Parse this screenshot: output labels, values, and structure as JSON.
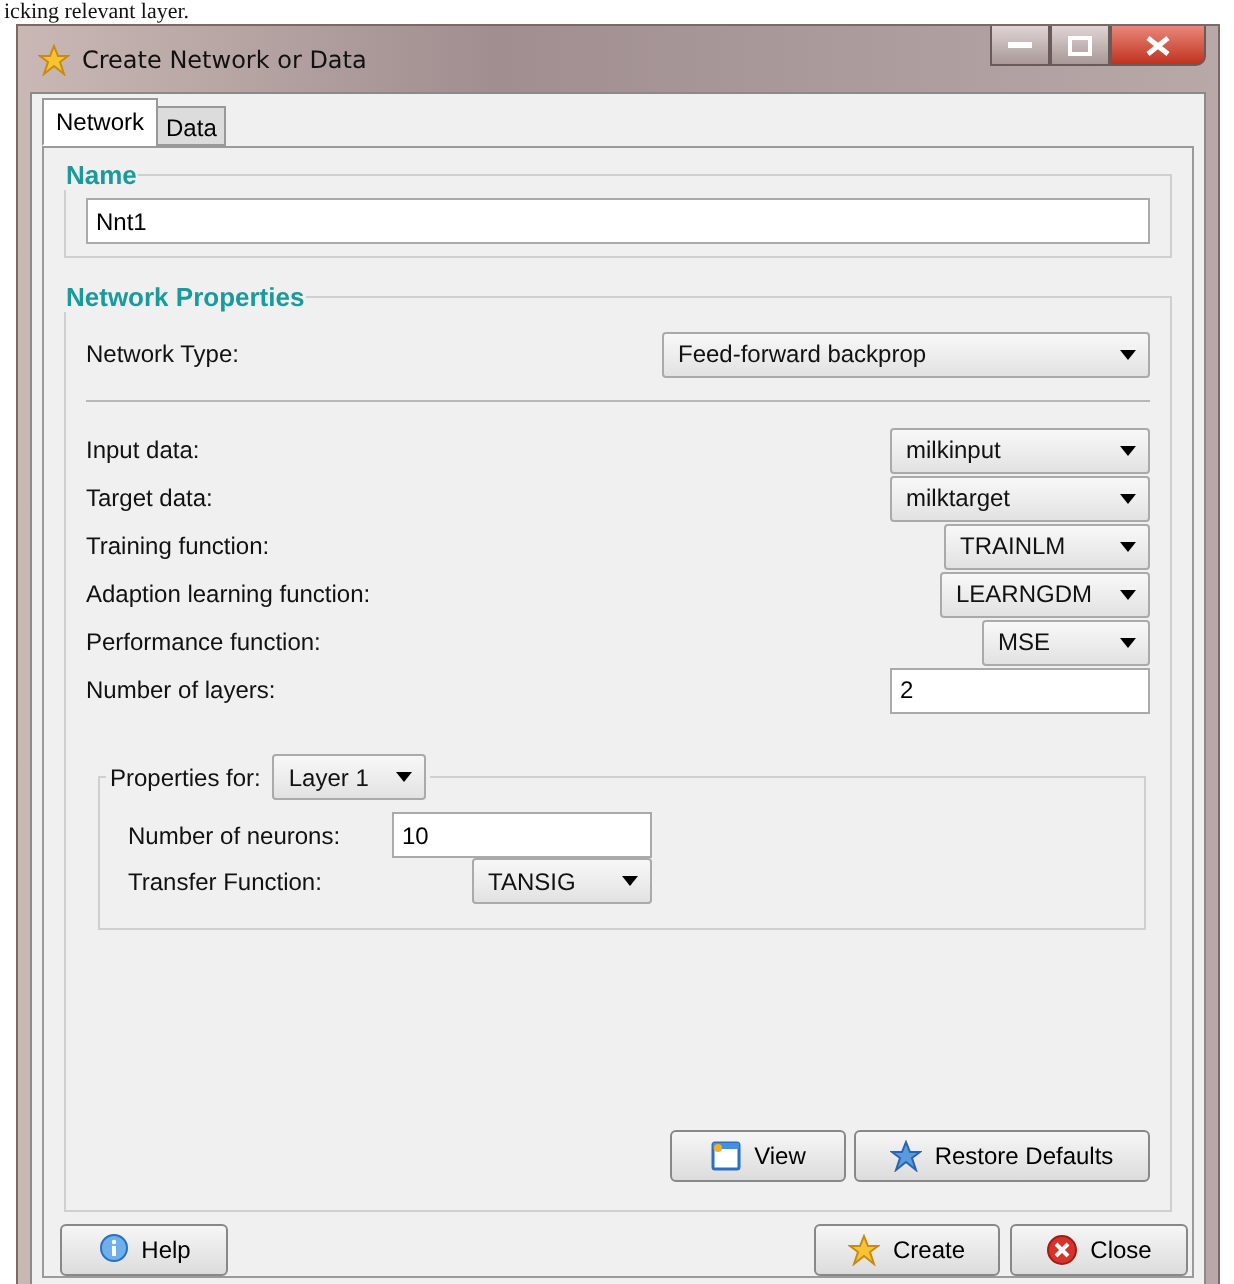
{
  "caption_text": "icking relevant layer.",
  "window": {
    "title": "Create Network or Data"
  },
  "tabs": [
    {
      "label": "Network",
      "selected": true
    },
    {
      "label": "Data",
      "selected": false
    }
  ],
  "name_group": {
    "title": "Name",
    "value": "Nnt1"
  },
  "network_properties": {
    "title": "Network Properties",
    "network_type": {
      "label": "Network Type:",
      "value": "Feed-forward backprop"
    },
    "fields": [
      {
        "kind": "select",
        "label": "Input data:",
        "value": "milkinput"
      },
      {
        "kind": "select",
        "label": "Target data:",
        "value": "milktarget"
      },
      {
        "kind": "select",
        "label": "Training function:",
        "value": "TRAINLM"
      },
      {
        "kind": "select",
        "label": "Adaption learning function:",
        "value": "LEARNGDM"
      },
      {
        "kind": "select",
        "label": "Performance function:",
        "value": "MSE"
      },
      {
        "kind": "input",
        "label": "Number of layers:",
        "value": "2"
      }
    ],
    "layer_properties": {
      "label": "Properties for:",
      "layer": "Layer 1",
      "fields": [
        {
          "kind": "input",
          "label": "Number of neurons:",
          "value": "10"
        },
        {
          "kind": "select",
          "label": "Transfer Function:",
          "value": "TANSIG"
        }
      ]
    },
    "buttons": [
      {
        "label": "View"
      },
      {
        "label": "Restore Defaults"
      }
    ]
  },
  "footer_buttons": [
    {
      "label": "Help"
    },
    {
      "label": "Create"
    },
    {
      "label": "Close"
    }
  ]
}
